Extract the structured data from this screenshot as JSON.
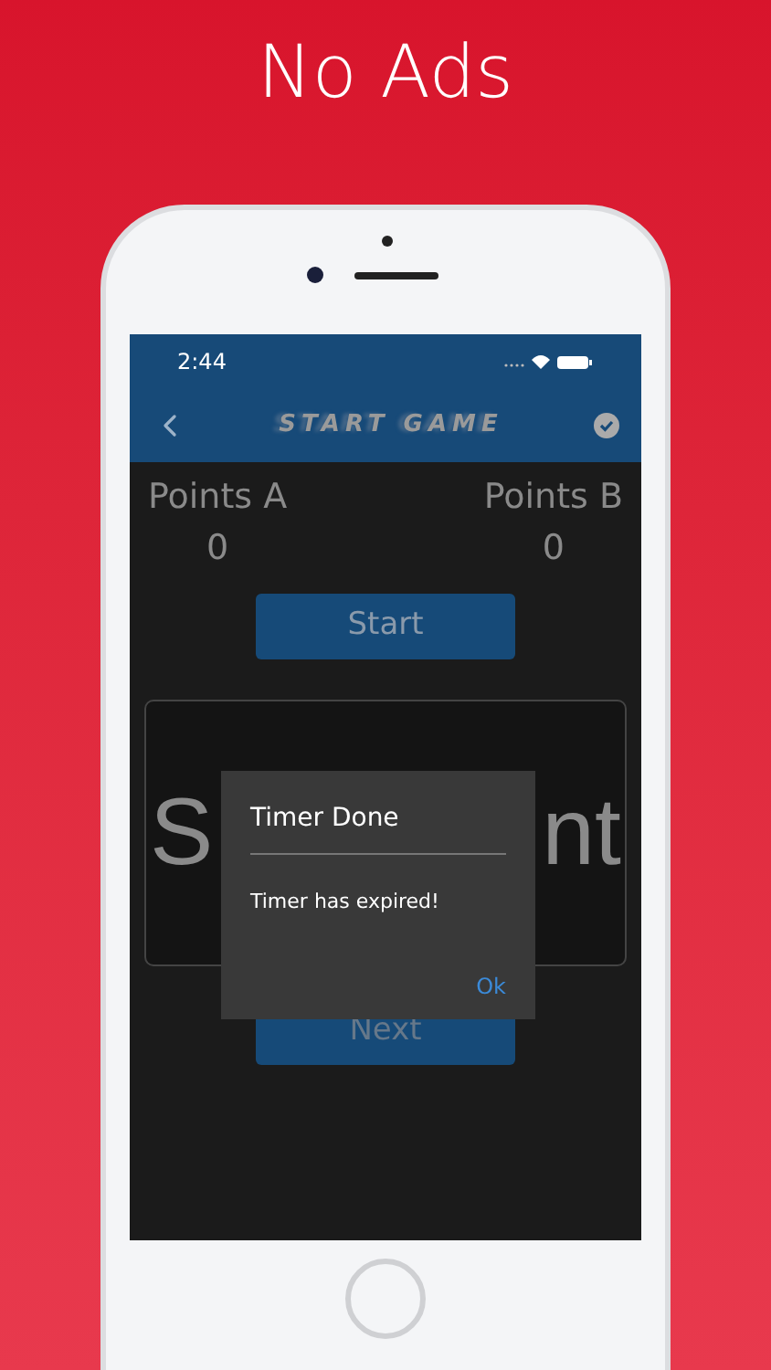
{
  "headline": "No Ads",
  "status_bar": {
    "time": "2:44"
  },
  "nav": {
    "title": "START GAME"
  },
  "scores": [
    {
      "label": "Points A",
      "value": "0"
    },
    {
      "label": "Points B",
      "value": "0"
    }
  ],
  "start_button": "Start",
  "card": {
    "text_left": "S",
    "text_right": "nt"
  },
  "next_button": "Next",
  "dialog": {
    "title": "Timer Done",
    "message": "Timer has expired!",
    "button": "Ok"
  }
}
